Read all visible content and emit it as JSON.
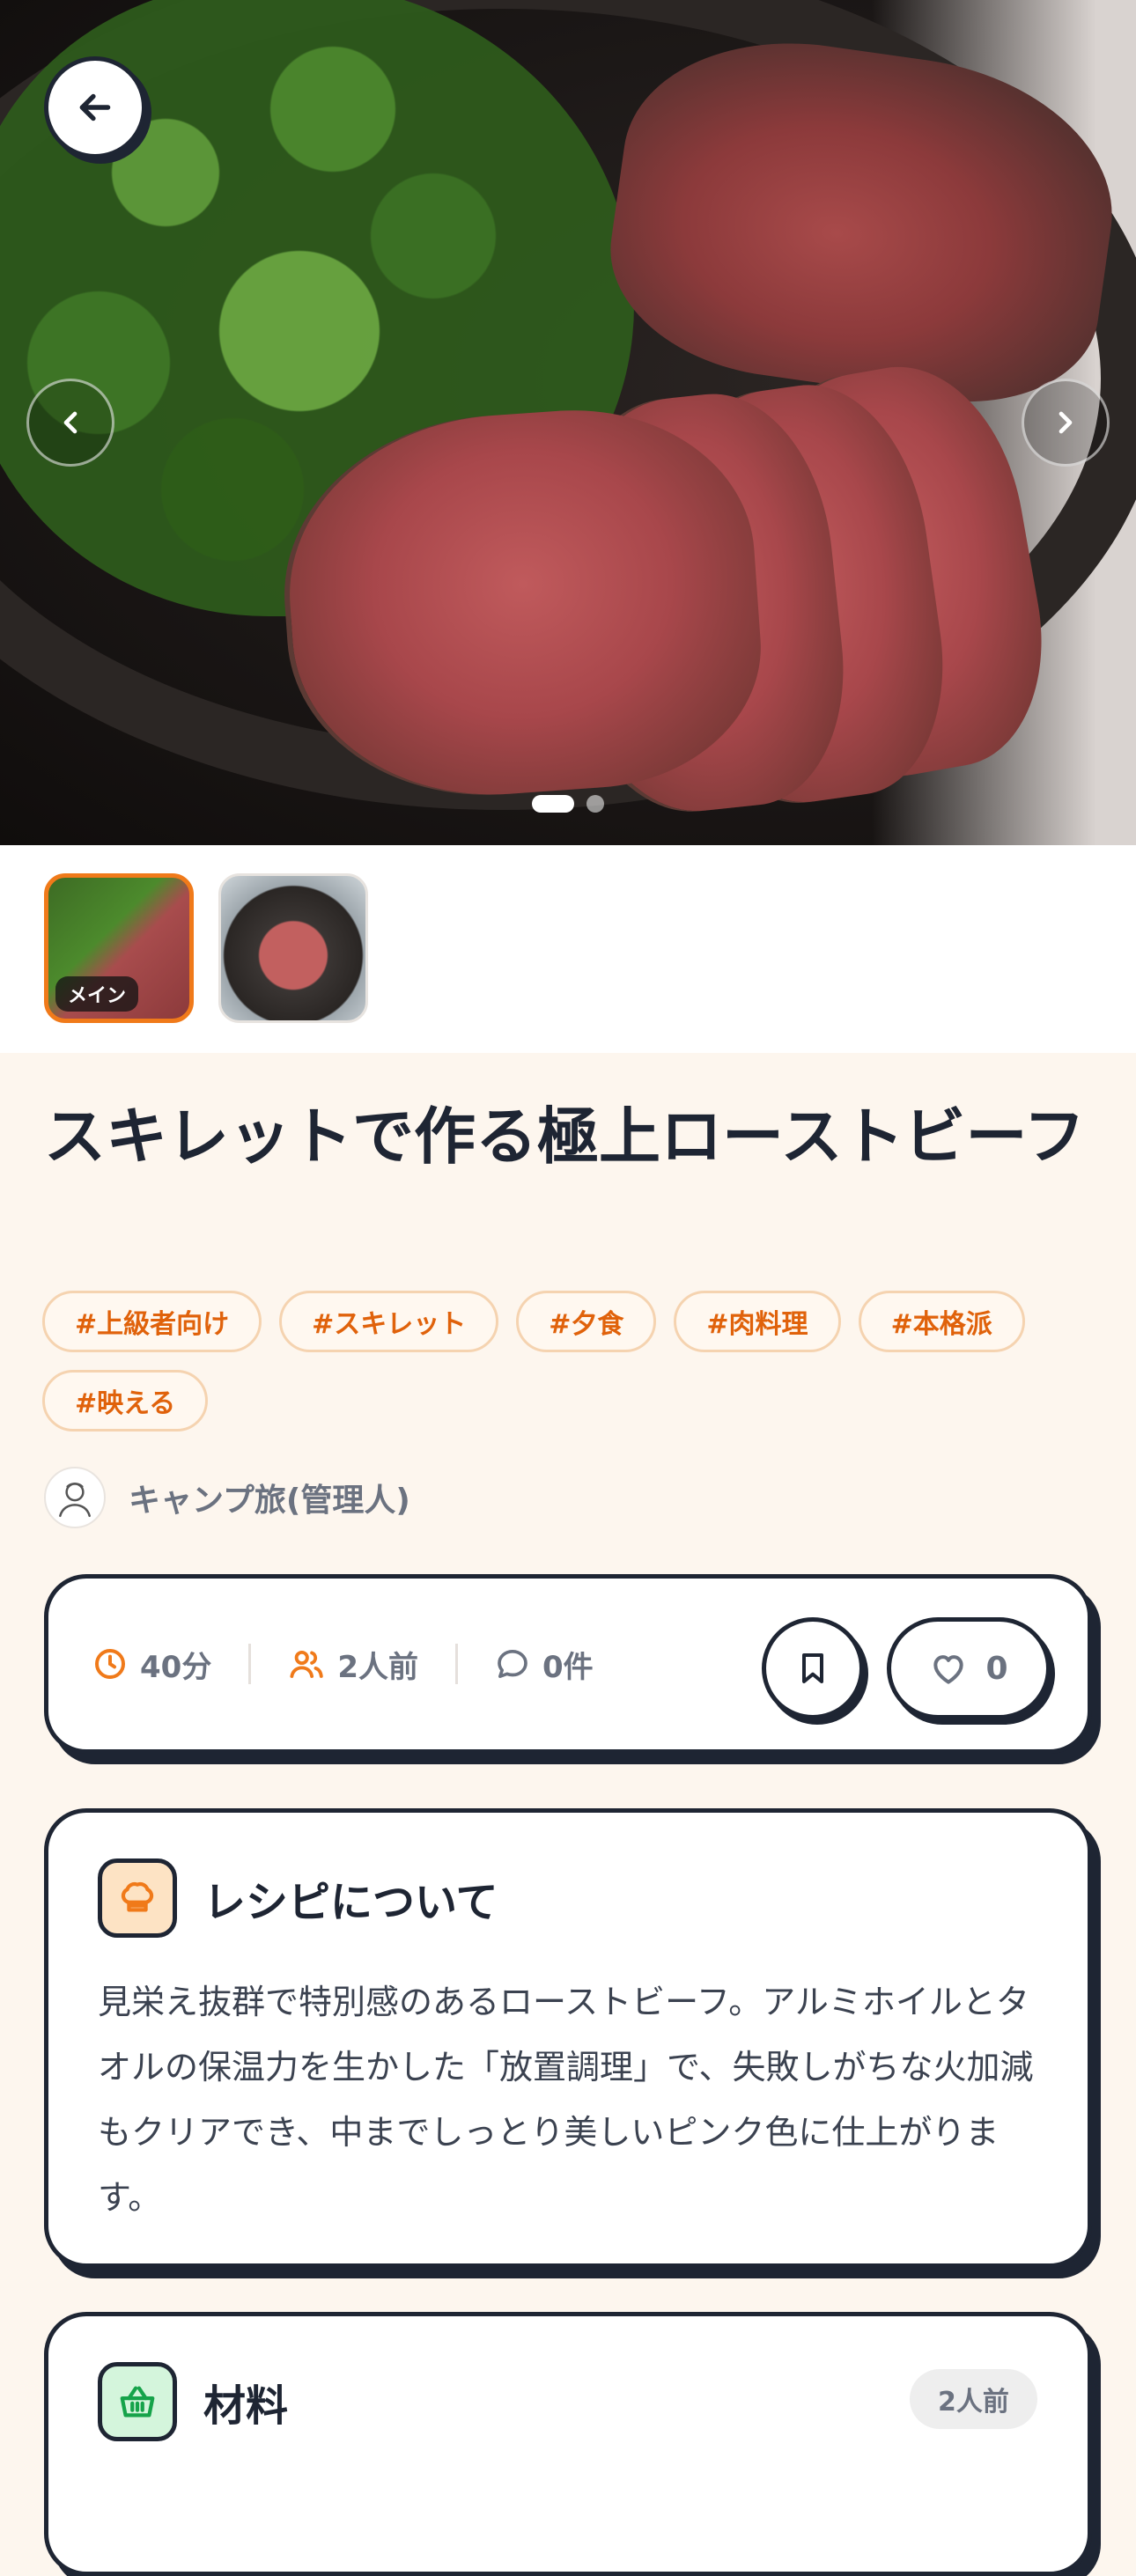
{
  "hero": {
    "image_alt": "スキレットで作る極上ローストビーフ",
    "slides_count": 2,
    "active_slide": 1
  },
  "thumbnails": [
    {
      "badge": "メイン",
      "selected": true
    },
    {
      "badge": "",
      "selected": false
    }
  ],
  "recipe": {
    "title": "スキレットで作る極上ローストビーフ",
    "tags": [
      "#上級者向け",
      "#スキレット",
      "#夕食",
      "#肉料理",
      "#本格派",
      "#映える"
    ],
    "author": "キャンプ旅(管理人)"
  },
  "stats": {
    "time": "40分",
    "servings": "2人前",
    "comments": "0件",
    "likes": "0"
  },
  "about": {
    "title": "レシピについて",
    "text": "見栄え抜群で特別感のあるローストビーフ。アルミホイルとタオルの保温力を生かした「放置調理」で、失敗しがちな火加減もクリアでき、中までしっとり美しいピンク色に仕上がります。"
  },
  "ingredients": {
    "title": "材料",
    "servings_badge": "2人前"
  },
  "colors": {
    "accent": "#f07a1a",
    "tag_text": "#e0620b",
    "ink": "#1e2533",
    "background": "#fdf6ee"
  }
}
